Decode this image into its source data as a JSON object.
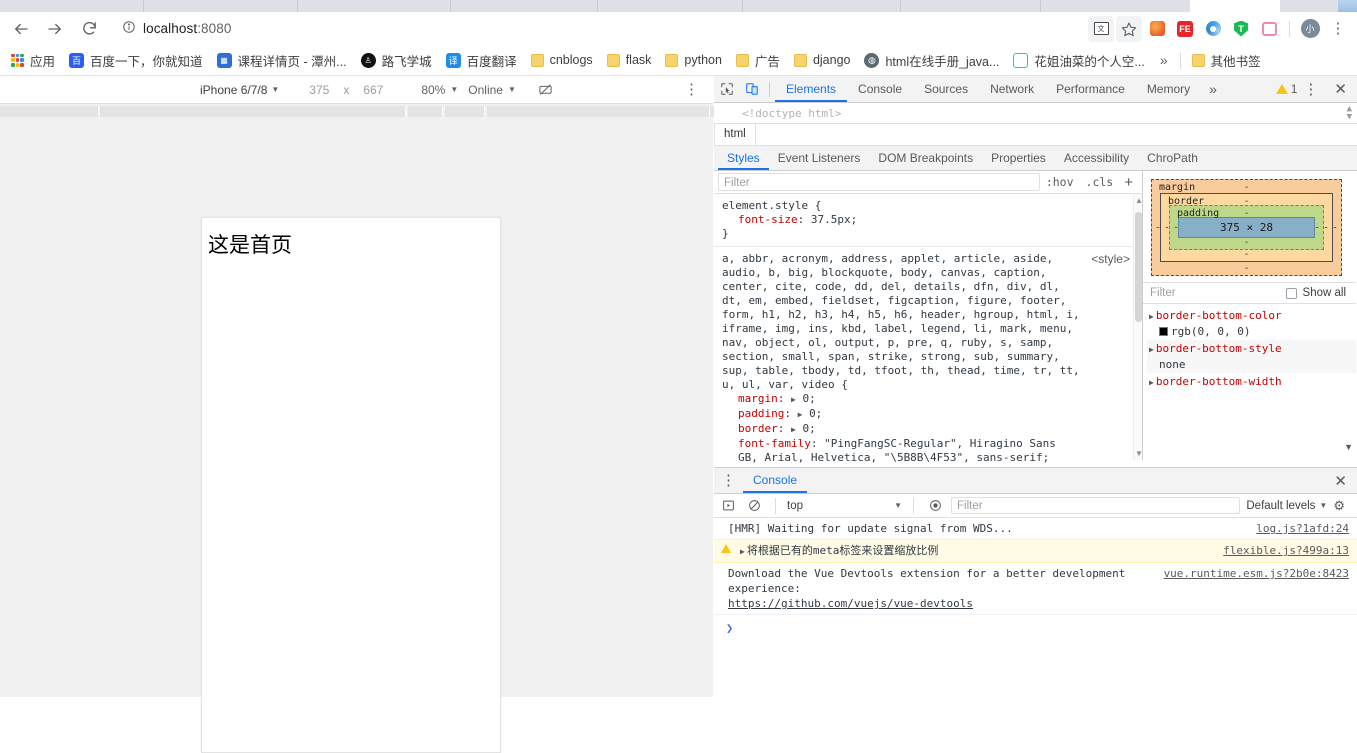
{
  "browser": {
    "url_host": "localhost",
    "url_port": ":8080",
    "nav": {
      "back": "back-arrow",
      "forward": "forward-arrow",
      "reload": "reload"
    },
    "omnibox_info_icon": "info-circle-icon",
    "toolbar_icons": [
      {
        "name": "translate-icon",
        "glyph": "文"
      },
      {
        "name": "bookmark-star-icon",
        "glyph": "☆"
      },
      {
        "name": "firefox-extension-icon",
        "glyph": ""
      },
      {
        "name": "fe-extension-icon",
        "glyph": "FE"
      },
      {
        "name": "compass-extension-icon",
        "glyph": ""
      },
      {
        "name": "shield-extension-icon",
        "glyph": "T"
      },
      {
        "name": "pink-extension-icon",
        "glyph": ""
      },
      {
        "name": "profile-avatar",
        "glyph": "小"
      },
      {
        "name": "chrome-menu-icon",
        "glyph": "⋮"
      }
    ]
  },
  "bookmarks": {
    "apps_label": "应用",
    "items": [
      {
        "label": "百度一下，你就知道",
        "icon": "baidu-favicon"
      },
      {
        "label": "课程详情页 - 潭州...",
        "icon": "course-favicon"
      },
      {
        "label": "路飞学城",
        "icon": "luffy-favicon"
      },
      {
        "label": "百度翻译",
        "icon": "baidu-translate-favicon"
      },
      {
        "label": "cnblogs",
        "icon": "folder-icon"
      },
      {
        "label": "flask",
        "icon": "folder-icon"
      },
      {
        "label": "python",
        "icon": "folder-icon"
      },
      {
        "label": "广告",
        "icon": "folder-icon"
      },
      {
        "label": "django",
        "icon": "folder-icon"
      },
      {
        "label": "html在线手册_java...",
        "icon": "globe-favicon"
      },
      {
        "label": "花姐油菜的个人空...",
        "icon": "robot-favicon"
      }
    ],
    "overflow": "»",
    "other_bookmarks": "其他书签"
  },
  "emulation": {
    "device": "iPhone 6/7/8",
    "width": "375",
    "times": "x",
    "height": "667",
    "zoom": "80%",
    "throttling": "Online",
    "rotate_icon": "rotate-device-icon",
    "menu_icon": "more-options-icon"
  },
  "page": {
    "heading": "这是首页"
  },
  "devtools": {
    "inspect_icon": "inspect-element-icon",
    "device_toolbar_icon": "toggle-device-toolbar-icon",
    "tabs": [
      "Elements",
      "Console",
      "Sources",
      "Network",
      "Performance",
      "Memory"
    ],
    "selected_tab": "Elements",
    "more_tabs": "»",
    "warning_count": "1",
    "settings_icon": "devtools-settings-icon",
    "close_icon": "✕",
    "dom_line": "<!doctype html>",
    "breadcrumb": [
      "html"
    ],
    "pane_tabs": [
      "Styles",
      "Event Listeners",
      "DOM Breakpoints",
      "Properties",
      "Accessibility",
      "ChroPath"
    ],
    "selected_pane_tab": "Styles",
    "styles": {
      "filter_placeholder": "Filter",
      "hov_label": ":hov",
      "cls_label": ".cls",
      "new_rule_label": "+",
      "rules": [
        {
          "selector": "element.style {",
          "source": "",
          "declarations": [
            {
              "prop": "font-size",
              "value": "37.5px;"
            }
          ],
          "close": "}"
        },
        {
          "selector": "a, abbr, acronym, address, applet, article, aside, audio, b, big, blockquote, body, canvas, caption, center, cite, code, dd, del, details, dfn, div, dl, dt, em, embed, fieldset, figcaption, figure, footer, form, h1, h2, h3, h4, h5, h6, header, hgroup, html, i, iframe, img, ins, kbd, label, legend, li, mark, menu, nav, object, ol, output, p, pre, q, ruby, s, samp, section, small, span, strike, strong, sub, summary, sup, table, tbody, td, tfoot, th, thead, time, tr, tt, u, ul, var, video {",
          "source": "<style>",
          "declarations": [
            {
              "prop": "margin",
              "value": "0;"
            },
            {
              "prop": "padding",
              "value": "0;"
            },
            {
              "prop": "border",
              "value": "0;"
            },
            {
              "prop": "font-family",
              "value": "\"PingFangSC-Regular\", Hiragino Sans GB, Arial, Helvetica, \"\\5B8B\\4F53\", sans-serif;"
            }
          ],
          "close": "}"
        }
      ]
    },
    "box_model": {
      "margin_label": "margin",
      "border_label": "border",
      "padding_label": "padding",
      "content": "375 × 28",
      "dash": "-"
    },
    "computed": {
      "filter_placeholder": "Filter",
      "show_all_label": "Show all",
      "properties": [
        {
          "name": "border-bottom-color",
          "value": "rgb(0, 0, 0)",
          "swatch": "#000000"
        },
        {
          "name": "border-bottom-style",
          "value": "none",
          "swatch": ""
        },
        {
          "name": "border-bottom-width",
          "value": "",
          "swatch": ""
        }
      ]
    }
  },
  "console": {
    "tab_label": "Console",
    "execute_icon": "execution-context-icon",
    "clear_icon": "clear-console-icon",
    "context": "top",
    "eye_icon": "live-expression-icon",
    "filter_placeholder": "Filter",
    "levels": "Default levels",
    "gear_icon": "console-settings-icon",
    "close_icon": "✕",
    "kebab_icon": "⋮",
    "messages": [
      {
        "type": "log",
        "text": "[HMR] Waiting for update signal from WDS...",
        "source": "log.js?1afd:24"
      },
      {
        "type": "warning",
        "text": "将根据已有的meta标签来设置缩放比例",
        "keyword": "meta",
        "source": "flexible.js?499a:13"
      },
      {
        "type": "log",
        "text": "Download the Vue Devtools extension for a better development experience:",
        "link": "https://github.com/vuejs/vue-devtools",
        "source": "vue.runtime.esm.js?2b0e:8423"
      }
    ],
    "prompt": "❯"
  }
}
